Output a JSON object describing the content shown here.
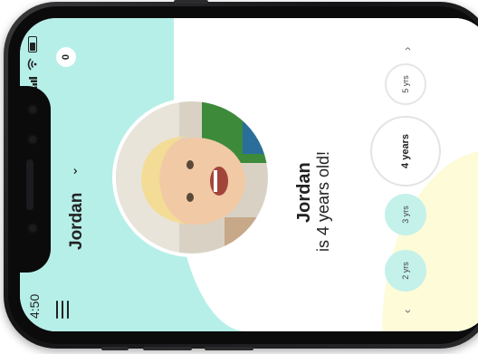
{
  "status": {
    "time": "4:50",
    "battery_level": 0.7
  },
  "header": {
    "child_name": "Jordan",
    "notification_count": "0"
  },
  "age_statement": {
    "name": "Jordan",
    "text": "is 4 years old!"
  },
  "age_picker": {
    "options": [
      {
        "label": "2 yrs",
        "selected": false
      },
      {
        "label": "3 yrs",
        "selected": false
      },
      {
        "label": "4 years",
        "selected": true
      },
      {
        "label": "5 yrs",
        "selected": false
      }
    ]
  },
  "colors": {
    "teal": "#b5efe8",
    "cream": "#fdfbd8",
    "text": "#222222"
  }
}
